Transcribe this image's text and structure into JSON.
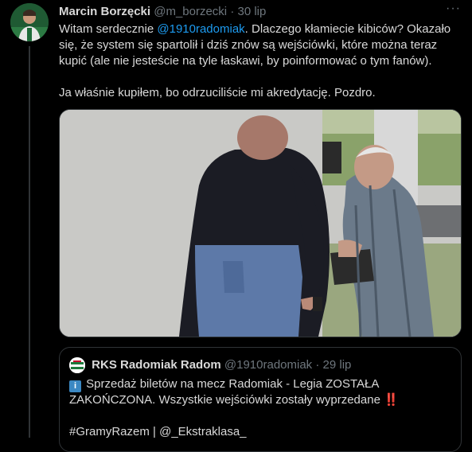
{
  "tweet": {
    "author_name": "Marcin Borzęcki",
    "handle": "@m_borzecki",
    "separator": "·",
    "date": "30 lip",
    "more_label": "···",
    "text_before_mention": "Witam serdecznie ",
    "mention": "@1910radomiak",
    "text_after_mention": ". Dlaczego kłamiecie kibiców? Okazało się, że system się spartolił i dziś znów są wejściówki, które można teraz kupić (ale nie jesteście na tyle łaskawi, by poinformować o tym fanów).\n\nJa właśnie kupiłem, bo odrzuciliście mi akredytację. Pozdro."
  },
  "quoted": {
    "author_name": "RKS Radomiak Radom",
    "handle": "@1910radomiak",
    "separator": "·",
    "date": "29 lip",
    "info_emoji": "i",
    "text": " Sprzedaż biletów na mecz Radomiak - Legia ZOSTAŁA ZAKOŃCZONA. Wszystkie wejściówki zostały wyprzedane ",
    "exclaim": "‼️",
    "hashtags": "#GramyRazem | @_Ekstraklasa_"
  },
  "colors": {
    "background": "#000000",
    "text": "#d9d9d9",
    "muted": "#6e767d",
    "link": "#1d9bf0",
    "border": "#2f3336"
  }
}
